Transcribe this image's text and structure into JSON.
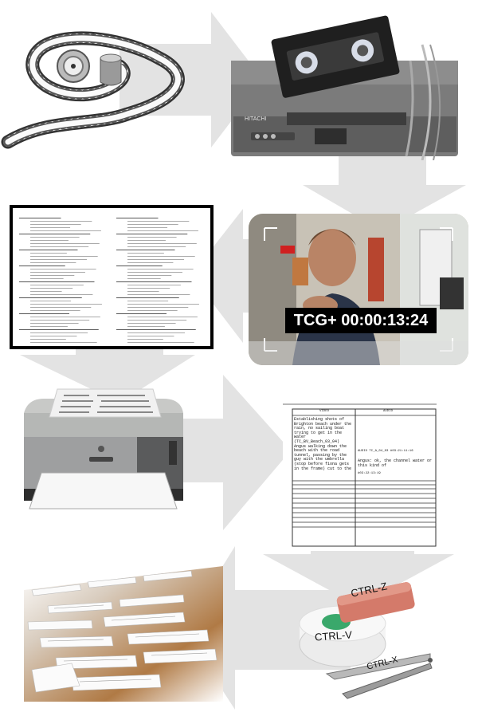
{
  "steps": [
    {
      "name": "film",
      "icon": "film-reel-icon"
    },
    {
      "name": "vcr",
      "icon": "vcr-player-icon",
      "brand": "HITACHI"
    },
    {
      "name": "transcript",
      "icon": "transcript-document-icon"
    },
    {
      "name": "timecode-video",
      "icon": "video-frame-icon",
      "timecode": "TCG+ 00:00:13:24"
    },
    {
      "name": "printer",
      "icon": "printer-icon"
    },
    {
      "name": "script",
      "icon": "script-document-icon",
      "col_video": "VIDEO",
      "col_audio": "AUDIO",
      "video_text": "Establishing shots of Brighton beach under the rain, no sailing boat trying to get in the water (TC_BV_Beach_03_04) Angus walking down the beach with the road tunnel, passing by the guy with the umbrella (stop before fiona gets in the frame) cut to the",
      "audio_text_1": "AUDIO TC_A_04_03 #03:21:11:16",
      "audio_text_2": "Angus: ok, the channel water or this kind of",
      "audio_tc": "#03:22:13:19"
    },
    {
      "name": "paper-strips",
      "icon": "paper-strips-icon"
    },
    {
      "name": "tools",
      "icon": "edit-tools-icon",
      "label_z": "CTRL-Z",
      "label_v": "CTRL-V",
      "label_x": "CTRL-X"
    }
  ],
  "arrows": [
    "right",
    "down",
    "left",
    "down",
    "right",
    "down",
    "left"
  ],
  "colors": {
    "arrow": "#e3e3e3",
    "tc_box": "#000000",
    "tc_text": "#ffffff"
  }
}
